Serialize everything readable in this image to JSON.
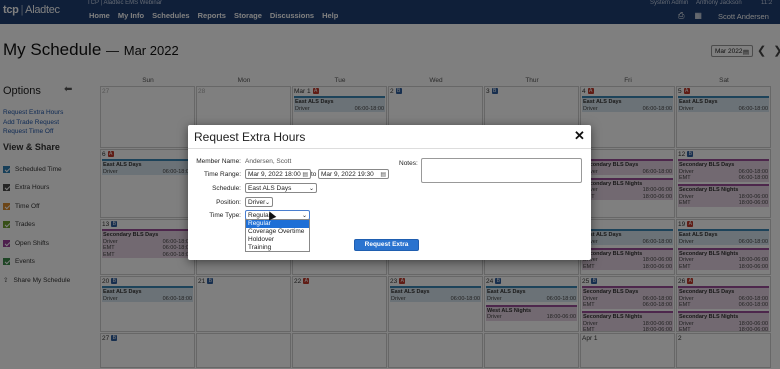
{
  "header": {
    "logo_text": "tcp",
    "brand": "Aladtec",
    "webinar_title": "TCP | Aladtec EMS Webinar",
    "nav": [
      "Home",
      "My Info",
      "Schedules",
      "Reports",
      "Storage",
      "Discussions",
      "Help"
    ],
    "system_admin": "System Admin",
    "admin_user": "Anthony Jackson",
    "clock": "11:2",
    "user_name": "Scott Andersen",
    "icons": [
      "print-icon",
      "grid-icon"
    ]
  },
  "page": {
    "title": "My Schedule",
    "dash": "—",
    "month": "Mar 2022",
    "month_select": "Mar 2022",
    "prev_label": "❮",
    "next_label": "❯"
  },
  "sidebar": {
    "options_title": "Options",
    "links": [
      "Request Extra Hours",
      "Add Trade Request",
      "Request Time Off"
    ],
    "view_share_title": "View & Share",
    "legend": [
      {
        "label": "Scheduled Time",
        "color": "#2f7fb3"
      },
      {
        "label": "Extra Hours",
        "color": "#4a4a4a"
      },
      {
        "label": "Time Off",
        "color": "#d98a2e"
      },
      {
        "label": "Trades",
        "color": "#6f9f2f"
      },
      {
        "label": "Open Shifts",
        "color": "#9b3f9b"
      },
      {
        "label": "Events",
        "color": "#3d8a4a"
      },
      {
        "label": "Share My Schedule",
        "color": ""
      }
    ]
  },
  "calendar": {
    "weekdays": [
      "Sun",
      "Mon",
      "Tue",
      "Wed",
      "Thur",
      "Fri",
      "Sat"
    ],
    "days": [
      {
        "num": "27",
        "muted": true,
        "events": []
      },
      {
        "num": "28",
        "muted": true,
        "events": []
      },
      {
        "num": "Mar 1",
        "badge": "A",
        "badge_color": "#c0392b",
        "events": [
          {
            "title": "East ALS Days",
            "kind": "blue",
            "rows": [
              [
                "Driver",
                "06:00-18:00"
              ]
            ]
          }
        ]
      },
      {
        "num": "2",
        "badge": "B",
        "badge_color": "#2f5f9f",
        "events": []
      },
      {
        "num": "3",
        "badge": "B",
        "badge_color": "#2f5f9f",
        "events": []
      },
      {
        "num": "4",
        "badge": "A",
        "badge_color": "#c0392b",
        "events": [
          {
            "title": "East ALS Days",
            "kind": "blue",
            "rows": [
              [
                "Driver",
                "06:00-18:00"
              ]
            ]
          }
        ]
      },
      {
        "num": "5",
        "badge": "A",
        "badge_color": "#c0392b",
        "events": [
          {
            "title": "East ALS Days",
            "kind": "blue",
            "rows": [
              [
                "Driver",
                "06:00-18:00"
              ]
            ]
          }
        ]
      },
      {
        "num": "6",
        "badge": "A",
        "badge_color": "#c0392b",
        "events": [
          {
            "title": "East ALS Days",
            "kind": "blue",
            "rows": [
              [
                "Driver",
                "06:00-18:00"
              ]
            ]
          }
        ]
      },
      {
        "num": "7",
        "events": []
      },
      {
        "num": "8",
        "events": []
      },
      {
        "num": "9",
        "events": []
      },
      {
        "num": "10",
        "events": []
      },
      {
        "num": "11",
        "events": [
          {
            "title": "Secondary BLS Days",
            "kind": "purple",
            "rows": [
              [
                "Driver",
                "06:00-18:00"
              ]
            ]
          },
          {
            "title": "Secondary BLS Nights",
            "kind": "purple",
            "rows": [
              [
                "Driver",
                "18:00-06:00"
              ],
              [
                "EMT",
                "18:00-06:00"
              ]
            ]
          }
        ]
      },
      {
        "num": "12",
        "badge": "B",
        "badge_color": "#2f5f9f",
        "events": [
          {
            "title": "Secondary BLS Days",
            "kind": "purple",
            "rows": [
              [
                "Driver",
                "06:00-18:00"
              ],
              [
                "EMT",
                "06:00-18:00"
              ]
            ]
          },
          {
            "title": "Secondary BLS Nights",
            "kind": "purple",
            "rows": [
              [
                "Driver",
                "18:00-06:00"
              ],
              [
                "EMT",
                "18:00-06:00"
              ]
            ]
          }
        ]
      },
      {
        "num": "13",
        "badge": "B",
        "badge_color": "#2f5f9f",
        "events": [
          {
            "title": "Secondary BLS Days",
            "kind": "purple",
            "rows": [
              [
                "Driver",
                "06:00-18:00"
              ],
              [
                "EMT",
                "06:00-18:00"
              ],
              [
                "EMT",
                "06:00-18:00"
              ]
            ]
          }
        ]
      },
      {
        "num": "14",
        "events": []
      },
      {
        "num": "15",
        "events": []
      },
      {
        "num": "16",
        "events": []
      },
      {
        "num": "17",
        "events": []
      },
      {
        "num": "18",
        "events": [
          {
            "title": "East ALS Days",
            "kind": "blue",
            "rows": [
              [
                "Driver",
                "06:00-18:00"
              ]
            ]
          },
          {
            "title": "Secondary BLS Nights",
            "kind": "purple",
            "rows": [
              [
                "Driver",
                "18:00-06:00"
              ],
              [
                "EMT",
                "18:00-06:00"
              ]
            ]
          }
        ]
      },
      {
        "num": "19",
        "badge": "A",
        "badge_color": "#c0392b",
        "events": [
          {
            "title": "East ALS Days",
            "kind": "blue",
            "rows": [
              [
                "Driver",
                "06:00-18:00"
              ]
            ]
          },
          {
            "title": "Secondary BLS Nights",
            "kind": "purple",
            "rows": [
              [
                "Driver",
                "18:00-06:00"
              ],
              [
                "EMT",
                "18:00-06:00"
              ]
            ]
          }
        ]
      },
      {
        "num": "20",
        "badge": "B",
        "badge_color": "#2f5f9f",
        "events": [
          {
            "title": "East ALS Days",
            "kind": "blue",
            "rows": [
              [
                "Driver",
                "06:00-18:00"
              ]
            ]
          }
        ]
      },
      {
        "num": "21",
        "badge": "B",
        "badge_color": "#2f5f9f",
        "events": []
      },
      {
        "num": "22",
        "badge": "A",
        "badge_color": "#c0392b",
        "events": []
      },
      {
        "num": "23",
        "badge": "A",
        "badge_color": "#c0392b",
        "events": [
          {
            "title": "East ALS Days",
            "kind": "blue",
            "rows": [
              [
                "Driver",
                "06:00-18:00"
              ]
            ]
          }
        ]
      },
      {
        "num": "24",
        "badge": "B",
        "badge_color": "#2f5f9f",
        "events": [
          {
            "title": "East ALS Days",
            "kind": "blue",
            "rows": [
              [
                "Driver",
                "06:00-18:00"
              ]
            ]
          },
          {
            "title": "West ALS Nights",
            "kind": "purple",
            "rows": [
              [
                "Driver",
                "18:00-06:00"
              ]
            ]
          }
        ]
      },
      {
        "num": "25",
        "badge": "B",
        "badge_color": "#2f5f9f",
        "events": [
          {
            "title": "Secondary BLS Days",
            "kind": "purple",
            "rows": [
              [
                "Driver",
                "06:00-18:00"
              ],
              [
                "EMT",
                "06:00-18:00"
              ]
            ]
          },
          {
            "title": "Secondary BLS Nights",
            "kind": "purple",
            "rows": [
              [
                "Driver",
                "18:00-06:00"
              ],
              [
                "EMT",
                "18:00-06:00"
              ]
            ]
          }
        ]
      },
      {
        "num": "26",
        "badge": "A",
        "badge_color": "#c0392b",
        "events": [
          {
            "title": "Secondary BLS Days",
            "kind": "purple",
            "rows": [
              [
                "Driver",
                "06:00-18:00"
              ],
              [
                "EMT",
                "06:00-18:00"
              ]
            ]
          },
          {
            "title": "Secondary BLS Nights",
            "kind": "purple",
            "rows": [
              [
                "Driver",
                "18:00-06:00"
              ],
              [
                "EMT",
                "18:00-06:00"
              ]
            ]
          }
        ]
      },
      {
        "num": "27",
        "badge": "B",
        "badge_color": "#2f5f9f",
        "events": []
      },
      {
        "num": "",
        "events": []
      },
      {
        "num": "",
        "events": []
      },
      {
        "num": "",
        "events": []
      },
      {
        "num": "",
        "events": []
      },
      {
        "num": "Apr 1",
        "events": []
      },
      {
        "num": "2",
        "events": []
      }
    ]
  },
  "modal": {
    "title": "Request Extra Hours",
    "close": "✕",
    "member_label": "Member Name:",
    "member_value": "Andersen, Scott",
    "time_range_label": "Time Range:",
    "time_start": "Mar 9, 2022 18:00",
    "to_label": "to",
    "time_end": "Mar 9, 2022 19:30",
    "schedule_label": "Schedule:",
    "schedule_value": "East ALS Days",
    "position_label": "Position:",
    "position_value": "Driver",
    "time_type_label": "Time Type:",
    "time_type_value": "Regular",
    "time_type_options": [
      "Regular",
      "Coverage Overtime",
      "Holdover",
      "Training"
    ],
    "notes_label": "Notes:",
    "submit_label": "Request Extra Hours"
  }
}
